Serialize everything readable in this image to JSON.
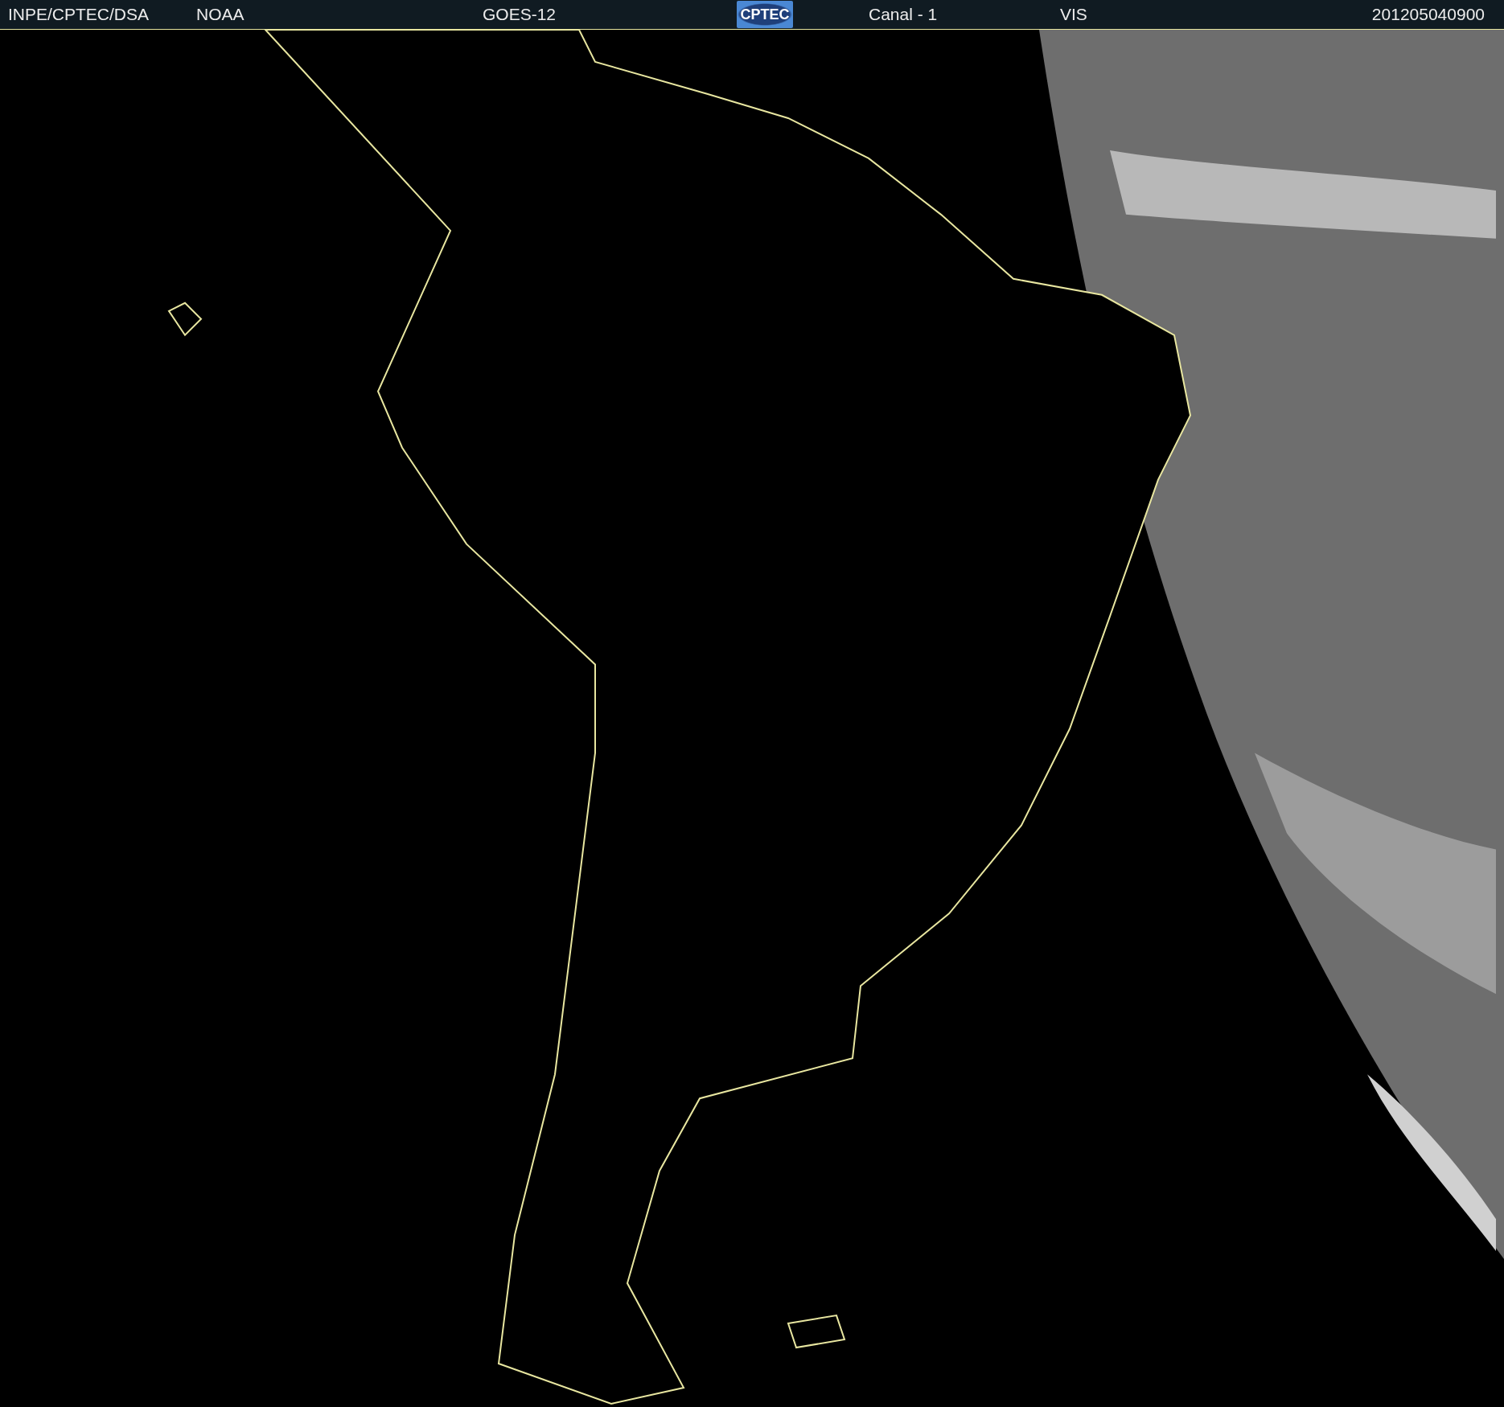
{
  "header": {
    "items": [
      {
        "kind": "text",
        "text": "INPE/CPTEC/DSA"
      },
      {
        "kind": "text",
        "text": "NOAA"
      },
      {
        "kind": "text",
        "text": "GOES-12"
      },
      {
        "kind": "logo",
        "text": "CPTEC"
      },
      {
        "kind": "text",
        "text": "Canal - 1"
      },
      {
        "kind": "text",
        "text": "VIS"
      },
      {
        "kind": "text",
        "text": "201205040900"
      }
    ]
  }
}
